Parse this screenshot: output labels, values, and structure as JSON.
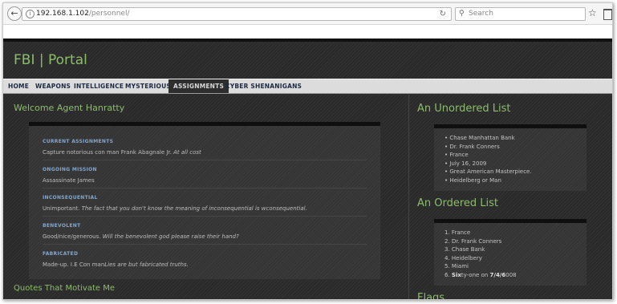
{
  "browser": {
    "url_host": "192.168.1.102",
    "url_path": "/personnel/",
    "search_placeholder": "Search"
  },
  "site": {
    "title": "FBI | Portal",
    "nav": [
      {
        "label": "HOME",
        "active": false
      },
      {
        "label": "WEAPONS",
        "active": false
      },
      {
        "label": "INTELLIGENCE",
        "active": false
      },
      {
        "label": "MYSTERIOUS",
        "active": false
      },
      {
        "label": "ASSIGNMENTS",
        "active": true
      },
      {
        "label": "CYBER SHENANIGANS",
        "active": false
      }
    ]
  },
  "main": {
    "welcome": "Welcome Agent Hanratty",
    "assignments": [
      {
        "term": "CURRENT ASSIGNMENTS",
        "desc_plain": "Capture notorious con man Frank Abagnale Jr. ",
        "desc_em": "At all cost"
      },
      {
        "term": "ONGOING MISSION",
        "desc_plain": "Assassinate James",
        "desc_em": ""
      },
      {
        "term": "INCONSEQUENTIAL",
        "desc_plain": "Unimportant. ",
        "desc_em": "The fact that you don't know the meaning of inconsequential is wconsequential."
      },
      {
        "term": "BENEVOLENT",
        "desc_plain": "Good/nice/generous. ",
        "desc_em": "Will the benevolent god please raise their hand?"
      },
      {
        "term": "FABRICATED",
        "desc_plain": "Made-up. I.E Con man",
        "desc_em": "Lies are but fabricated truths."
      }
    ],
    "quotes_heading": "Quotes That Motivate Me"
  },
  "sidebar": {
    "unordered_heading": "An Unordered List",
    "unordered": [
      "Chase Manhattan Bank",
      "Dr. Frank Conners",
      "France",
      "July 16, 2009",
      "Great American Masterpiece.",
      "Heidelberg or Man"
    ],
    "ordered_heading": "An Ordered List",
    "ordered": [
      {
        "marker": "1.",
        "text": "France"
      },
      {
        "marker": "2.",
        "text": "Dr. Frank Conners"
      },
      {
        "marker": "3.",
        "text": "Chase Bank"
      },
      {
        "marker": "4.",
        "text": "Heidelbery"
      },
      {
        "marker": "5.",
        "text": "Miami"
      }
    ],
    "ordered_last": {
      "marker": "6.",
      "pre": "Six",
      "mid1": "ty-one",
      "mid2": " on ",
      "b2": "7/4/6",
      "tail": "008"
    },
    "cut_heading": "Flags"
  }
}
